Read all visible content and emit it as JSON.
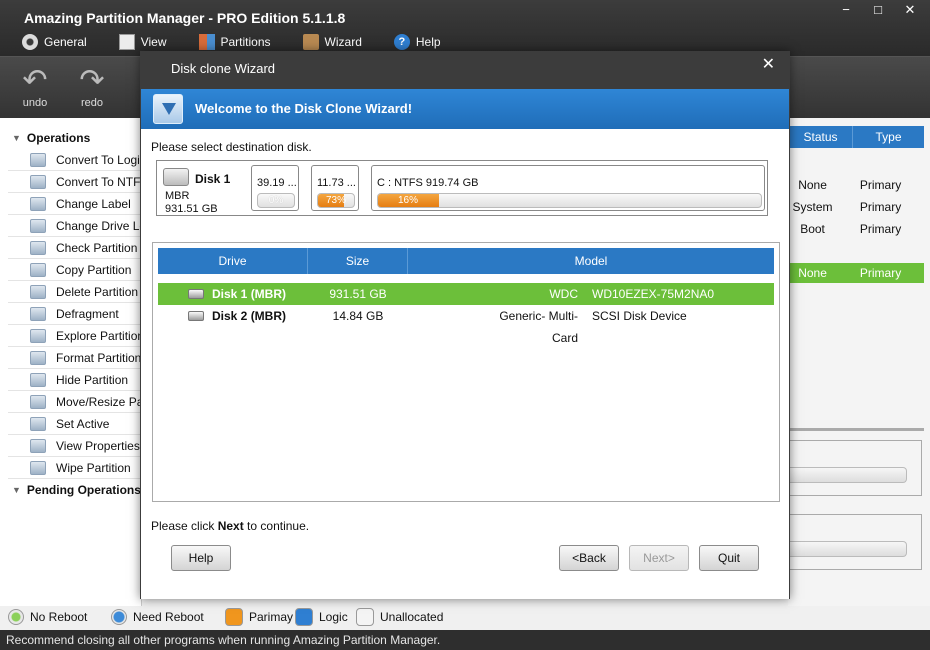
{
  "app": {
    "title": "Amazing Partition Manager - PRO Edition 5.1.1.8",
    "min": "−",
    "max": "□",
    "close": "✕"
  },
  "menu": {
    "general": "General",
    "view": "View",
    "partitions": "Partitions",
    "wizard": "Wizard",
    "help": "Help"
  },
  "toolbar": {
    "undo": "undo",
    "redo": "redo"
  },
  "operations": {
    "title": "Operations",
    "items": [
      "Convert To Logical",
      "Convert To NTFS",
      "Change Label",
      "Change Drive Letter",
      "Check Partition",
      "Copy Partition",
      "Delete Partition",
      "Defragment",
      "Explore Partition",
      "Format Partition",
      "Hide Partition",
      "Move/Resize Partition",
      "Set Active",
      "View Properties",
      "Wipe Partition"
    ],
    "pending_title": "Pending Operations"
  },
  "partition_list": {
    "headers": {
      "status": "Status",
      "type": "Type"
    },
    "rows": [
      {
        "status": "None",
        "type": "Primary"
      },
      {
        "status": "System",
        "type": "Primary"
      },
      {
        "status": "Boot",
        "type": "Primary"
      },
      {
        "status": "None",
        "type": "Primary"
      }
    ]
  },
  "legend": {
    "no_reboot": "No Reboot",
    "need_reboot": "Need Reboot",
    "primary": "Parimay",
    "logic": "Logic",
    "unallocated": "Unallocated",
    "colors": {
      "primary": "#f0961e",
      "logic": "#2f7fd2",
      "unallocated": "#f4f4f4"
    }
  },
  "status": "Recommend closing all other programs when running Amazing Partition Manager.",
  "dialog": {
    "title": "Disk clone Wizard",
    "close": "✕",
    "banner": "Welcome to the Disk Clone Wizard!",
    "hint": "Please select destination disk.",
    "disk_map": {
      "name": "Disk 1",
      "type": "MBR",
      "size": "931.51 GB",
      "partitions": [
        {
          "label": "39.19 ...",
          "pct_label": "0%",
          "pct": 0
        },
        {
          "label": "11.73 ...",
          "pct_label": "73%",
          "pct": 0.73
        },
        {
          "label": "C : NTFS 919.74 GB",
          "pct_label": "16%",
          "pct": 0.16
        }
      ]
    },
    "table": {
      "headers": {
        "drive": "Drive",
        "size": "Size",
        "model": "Model"
      },
      "rows": [
        {
          "drive": "Disk 1 (MBR)",
          "size": "931.51 GB",
          "vendor": "WDC",
          "model": "WD10EZEX-75M2NA0",
          "selected": true
        },
        {
          "drive": "Disk 2 (MBR)",
          "size": "14.84 GB",
          "vendor": "Generic- Multi-Card",
          "model": "SCSI Disk Device",
          "selected": false
        }
      ]
    },
    "continue_prefix": "Please click ",
    "continue_bold": "Next",
    "continue_suffix": " to continue.",
    "buttons": {
      "help": "Help",
      "back": "<Back",
      "next": "Next>",
      "quit": "Quit"
    }
  }
}
